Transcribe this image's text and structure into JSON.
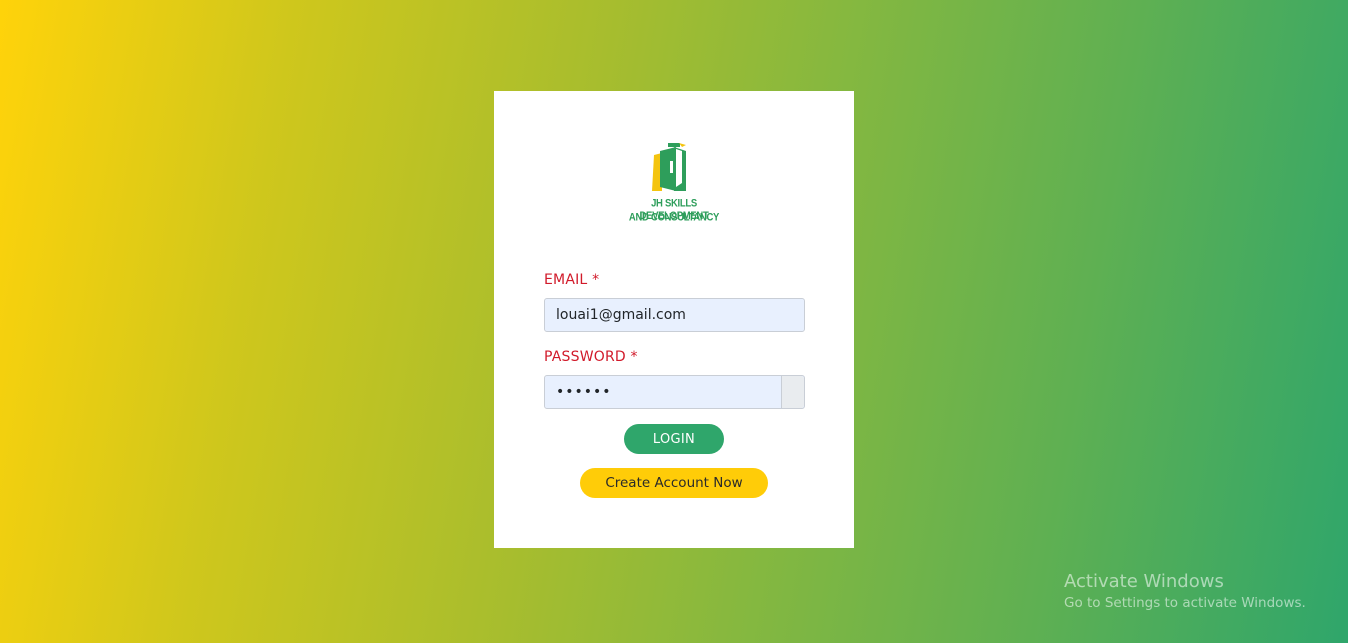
{
  "logo": {
    "line1": "JH SKILLS DEVELOPMENT",
    "line2": "AND CONSULTANCY",
    "icon": "jh-building-logo-icon"
  },
  "form": {
    "email_label": "EMAIL *",
    "email_value": "louai1@gmail.com",
    "password_label": "PASSWORD *",
    "password_value": "••••••",
    "login_label": "LOGIN",
    "create_account_label": "Create Account Now"
  },
  "watermark": {
    "title": "Activate Windows",
    "subtitle": "Go to Settings to activate Windows."
  },
  "colors": {
    "gradient_start": "#ffd30a",
    "gradient_end": "#2fa66b",
    "label_red": "#d11a2a",
    "login_green": "#2fa66b",
    "create_yellow": "#ffcc08",
    "input_bg": "#e8f0fe"
  }
}
